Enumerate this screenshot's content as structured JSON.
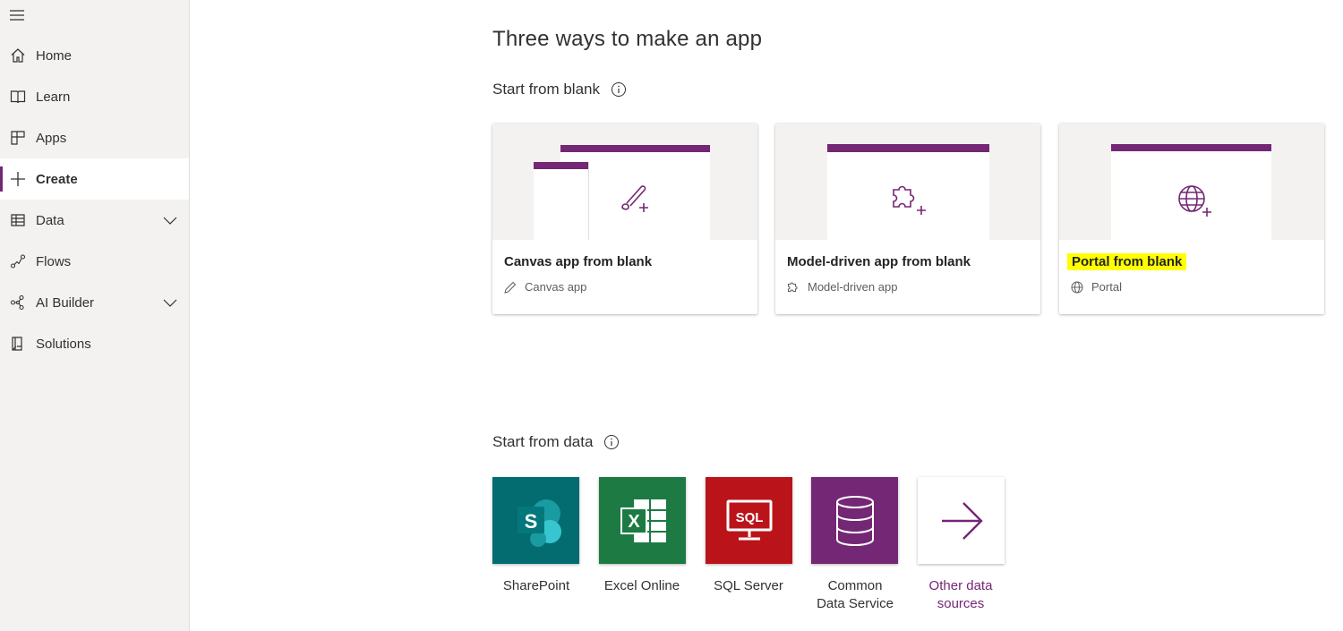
{
  "sidebar": {
    "items": [
      {
        "label": "Home",
        "icon": "home-icon"
      },
      {
        "label": "Learn",
        "icon": "book-icon"
      },
      {
        "label": "Apps",
        "icon": "apps-icon"
      },
      {
        "label": "Create",
        "icon": "plus-icon",
        "active": true
      },
      {
        "label": "Data",
        "icon": "table-icon",
        "expandable": true
      },
      {
        "label": "Flows",
        "icon": "flow-icon"
      },
      {
        "label": "AI Builder",
        "icon": "ai-builder-icon",
        "expandable": true
      },
      {
        "label": "Solutions",
        "icon": "solutions-icon"
      }
    ]
  },
  "main": {
    "title": "Three ways to make an app",
    "blank_section": "Start from blank",
    "data_section": "Start from data",
    "cards": [
      {
        "title": "Canvas app from blank",
        "subtitle": "Canvas app",
        "icon": "pencil-icon"
      },
      {
        "title": "Model-driven app from blank",
        "subtitle": "Model-driven app",
        "icon": "puzzle-icon"
      },
      {
        "title": "Portal from blank",
        "subtitle": "Portal",
        "icon": "globe-icon",
        "highlighted": true
      }
    ],
    "data_sources": [
      {
        "label": "SharePoint",
        "color": "#036c70"
      },
      {
        "label": "Excel Online",
        "color": "#1d7a43"
      },
      {
        "label": "SQL Server",
        "color": "#ba141a"
      },
      {
        "label": "Common Data Service",
        "label_line1": "Common",
        "label_line2": "Data Service",
        "color": "#742774"
      },
      {
        "label": "Other data sources",
        "label_line1": "Other data",
        "label_line2": "sources",
        "color": "#ffffff"
      }
    ]
  },
  "colors": {
    "accent": "#742774",
    "highlight": "#ffff00",
    "sidebar_bg": "#f3f2f1"
  }
}
